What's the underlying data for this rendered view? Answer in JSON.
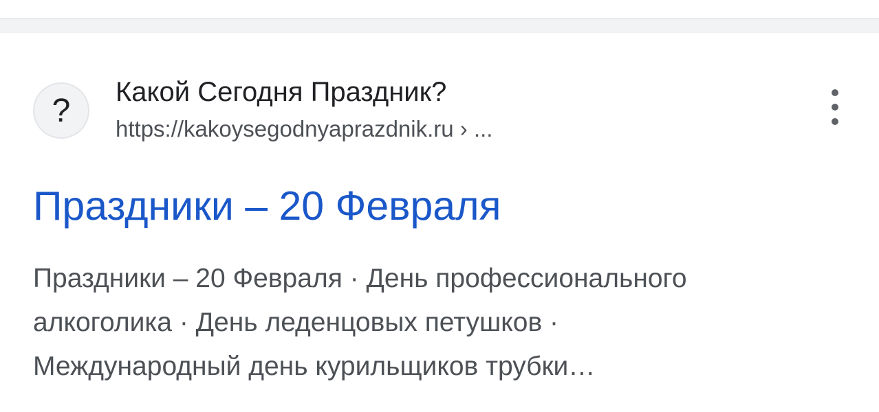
{
  "result": {
    "favicon_glyph": "?",
    "site_name": "Какой Сегодня Праздник?",
    "url": "https://kakoysegodnyaprazdnik.ru",
    "url_suffix": " › ...",
    "more_icon": "three-dots-vertical-icon",
    "title": "Праздники – 20 Февраля",
    "title_color": "#1a57c9",
    "snippet_lines": [
      "Праздники – 20 Февраля · День профессионального",
      "алкоголика · День леденцовых петушков ·",
      "Международный день курильщиков трубки…"
    ]
  }
}
